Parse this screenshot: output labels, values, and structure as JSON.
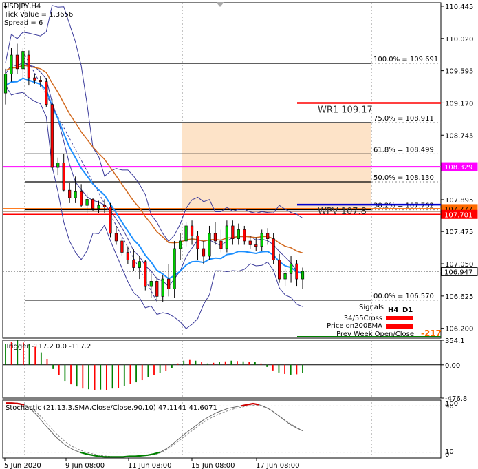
{
  "header": {
    "symbol": "USDJPY,H4",
    "tick_value": "Tick Value = 1.3656",
    "spread": "Spread = 6"
  },
  "chart_data": {
    "type": "candlestick",
    "price_axis": {
      "ticks": [
        "110.445",
        "110.020",
        "109.595",
        "109.170",
        "108.745",
        "108.320",
        "107.895",
        "107.475",
        "107.050",
        "106.625",
        "106.200"
      ],
      "ylim": [
        106.07,
        110.49
      ]
    },
    "price_tags": [
      {
        "value": 108.329,
        "label": "108.329",
        "bg": "#ff00ff",
        "fg": "#ffffff"
      },
      {
        "value": 107.777,
        "label": "107.777",
        "bg": "#ff6a00",
        "fg": "#000000"
      },
      {
        "value": 107.701,
        "label": "107.701",
        "bg": "#ff0000",
        "fg": "#ffffff"
      },
      {
        "value": 106.947,
        "label": "106.947",
        "bg": "#ffffff",
        "fg": "#000000"
      }
    ],
    "time_labels": [
      "5 Jun 2020",
      "9 Jun 08:00",
      "11 Jun 08:00",
      "15 Jun 08:00",
      "17 Jun 08:00"
    ],
    "fib_levels": [
      {
        "label": "100.0% = 109.691",
        "value": 109.691
      },
      {
        "label": "75.0% = 108.911",
        "value": 108.911
      },
      {
        "label": "61.8% = 108.499",
        "value": 108.499
      },
      {
        "label": "50.0% = 108.130",
        "value": 108.13
      },
      {
        "label": "38.2% = 107.762",
        "value": 107.762
      },
      {
        "label": "00.0% = 106.570",
        "value": 106.57
      }
    ],
    "levels": [
      {
        "name": "WR1",
        "value": 109.17,
        "label": "WR1   109.17",
        "color": "#ff0000"
      },
      {
        "name": "WPV",
        "value": 107.83,
        "label": "WPV   107.8",
        "color": "#0000cc"
      }
    ],
    "candles": [
      {
        "o": 109.3,
        "h": 109.62,
        "l": 109.15,
        "c": 109.55
      },
      {
        "o": 109.55,
        "h": 109.9,
        "l": 109.45,
        "c": 109.8
      },
      {
        "o": 109.8,
        "h": 109.95,
        "l": 109.55,
        "c": 109.62
      },
      {
        "o": 109.62,
        "h": 109.9,
        "l": 109.5,
        "c": 109.85
      },
      {
        "o": 109.8,
        "h": 109.86,
        "l": 109.4,
        "c": 109.5
      },
      {
        "o": 109.5,
        "h": 109.55,
        "l": 109.42,
        "c": 109.47
      },
      {
        "o": 109.47,
        "h": 109.52,
        "l": 109.38,
        "c": 109.45
      },
      {
        "o": 109.45,
        "h": 109.5,
        "l": 109.12,
        "c": 109.15
      },
      {
        "o": 109.15,
        "h": 109.22,
        "l": 108.28,
        "c": 108.32
      },
      {
        "o": 108.32,
        "h": 108.45,
        "l": 108.22,
        "c": 108.38
      },
      {
        "o": 108.38,
        "h": 108.5,
        "l": 108.0,
        "c": 108.02
      },
      {
        "o": 108.02,
        "h": 108.12,
        "l": 107.85,
        "c": 107.92
      },
      {
        "o": 107.92,
        "h": 108.2,
        "l": 107.85,
        "c": 108.0
      },
      {
        "o": 108.0,
        "h": 108.1,
        "l": 107.8,
        "c": 107.82
      },
      {
        "o": 107.82,
        "h": 107.98,
        "l": 107.72,
        "c": 107.9
      },
      {
        "o": 107.9,
        "h": 107.92,
        "l": 107.75,
        "c": 107.78
      },
      {
        "o": 107.78,
        "h": 107.88,
        "l": 107.72,
        "c": 107.82
      },
      {
        "o": 107.82,
        "h": 107.9,
        "l": 107.72,
        "c": 107.8
      },
      {
        "o": 107.8,
        "h": 107.85,
        "l": 107.4,
        "c": 107.45
      },
      {
        "o": 107.45,
        "h": 107.55,
        "l": 107.3,
        "c": 107.35
      },
      {
        "o": 107.35,
        "h": 107.4,
        "l": 107.15,
        "c": 107.2
      },
      {
        "o": 107.2,
        "h": 107.28,
        "l": 107.05,
        "c": 107.1
      },
      {
        "o": 107.1,
        "h": 107.25,
        "l": 106.95,
        "c": 107.0
      },
      {
        "o": 107.0,
        "h": 107.15,
        "l": 106.85,
        "c": 107.08
      },
      {
        "o": 107.08,
        "h": 107.1,
        "l": 106.7,
        "c": 106.75
      },
      {
        "o": 106.75,
        "h": 106.92,
        "l": 106.6,
        "c": 106.82
      },
      {
        "o": 106.82,
        "h": 106.88,
        "l": 106.55,
        "c": 106.62
      },
      {
        "o": 106.62,
        "h": 106.9,
        "l": 106.55,
        "c": 106.85
      },
      {
        "o": 106.85,
        "h": 107.05,
        "l": 106.62,
        "c": 106.72
      },
      {
        "o": 106.72,
        "h": 107.35,
        "l": 106.6,
        "c": 107.25
      },
      {
        "o": 107.25,
        "h": 107.45,
        "l": 107.1,
        "c": 107.35
      },
      {
        "o": 107.35,
        "h": 107.6,
        "l": 107.28,
        "c": 107.55
      },
      {
        "o": 107.55,
        "h": 107.62,
        "l": 107.3,
        "c": 107.42
      },
      {
        "o": 107.42,
        "h": 107.48,
        "l": 107.1,
        "c": 107.25
      },
      {
        "o": 107.25,
        "h": 107.35,
        "l": 107.05,
        "c": 107.15
      },
      {
        "o": 107.15,
        "h": 107.55,
        "l": 107.1,
        "c": 107.45
      },
      {
        "o": 107.45,
        "h": 107.6,
        "l": 107.3,
        "c": 107.35
      },
      {
        "o": 107.35,
        "h": 107.5,
        "l": 107.2,
        "c": 107.25
      },
      {
        "o": 107.25,
        "h": 107.62,
        "l": 107.2,
        "c": 107.55
      },
      {
        "o": 107.55,
        "h": 107.62,
        "l": 107.3,
        "c": 107.38
      },
      {
        "o": 107.38,
        "h": 107.58,
        "l": 107.3,
        "c": 107.5
      },
      {
        "o": 107.5,
        "h": 107.55,
        "l": 107.3,
        "c": 107.35
      },
      {
        "o": 107.35,
        "h": 107.42,
        "l": 107.25,
        "c": 107.3
      },
      {
        "o": 107.3,
        "h": 107.4,
        "l": 107.22,
        "c": 107.28
      },
      {
        "o": 107.28,
        "h": 107.5,
        "l": 107.22,
        "c": 107.45
      },
      {
        "o": 107.45,
        "h": 107.52,
        "l": 107.3,
        "c": 107.38
      },
      {
        "o": 107.38,
        "h": 107.45,
        "l": 107.05,
        "c": 107.1
      },
      {
        "o": 107.1,
        "h": 107.18,
        "l": 106.8,
        "c": 106.85
      },
      {
        "o": 106.85,
        "h": 106.98,
        "l": 106.75,
        "c": 106.92
      },
      {
        "o": 106.92,
        "h": 107.15,
        "l": 106.8,
        "c": 107.05
      },
      {
        "o": 107.05,
        "h": 107.1,
        "l": 106.75,
        "c": 106.85
      },
      {
        "o": 106.85,
        "h": 107.0,
        "l": 106.72,
        "c": 106.95
      }
    ],
    "signals": {
      "title": "Signals",
      "h4": "H4",
      "d1": "D1",
      "rows": [
        "34/55Cross",
        "Price on200EMA",
        "Prev Week Open/Close"
      ],
      "row_value": "-217"
    },
    "trigger": {
      "label": "Trigger -117.2 0.0 -117.2",
      "ticks": [
        "354.1",
        "0.00",
        "-476.8"
      ],
      "ylim": [
        -476.8,
        354.1
      ],
      "values": [
        300,
        330,
        350,
        320,
        300,
        260,
        180,
        80,
        -60,
        -150,
        -230,
        -280,
        -310,
        -340,
        -350,
        -360,
        -355,
        -360,
        -340,
        -330,
        -300,
        -270,
        -250,
        -220,
        -180,
        -150,
        -120,
        -90,
        -50,
        20,
        60,
        70,
        60,
        40,
        20,
        30,
        40,
        50,
        60,
        55,
        50,
        45,
        40,
        20,
        -30,
        -80,
        -110,
        -130,
        -140,
        -135,
        -117
      ]
    },
    "stochastic": {
      "label": "Stochastic (21,13,3,SMA,Close/Close,90,10) 47.1141 41.6071",
      "ticks": [
        "100",
        "90",
        "10",
        "0"
      ],
      "ylim": [
        0,
        100
      ],
      "main": [
        95,
        95,
        94,
        92,
        85,
        75,
        62,
        50,
        38,
        28,
        20,
        14,
        10,
        7,
        5,
        3,
        2,
        2,
        2,
        2,
        3,
        3,
        4,
        5,
        7,
        10,
        16,
        24,
        33,
        42,
        50,
        58,
        66,
        72,
        78,
        82,
        86,
        88,
        90,
        92,
        94,
        92,
        88,
        82,
        74,
        66,
        58,
        52,
        47
      ],
      "signal": [
        94,
        95,
        95,
        93,
        88,
        80,
        70,
        58,
        46,
        36,
        27,
        20,
        15,
        11,
        8,
        6,
        4,
        3,
        2,
        2,
        2,
        3,
        3,
        4,
        5,
        7,
        11,
        17,
        25,
        33,
        41,
        49,
        57,
        64,
        70,
        75,
        79,
        83,
        86,
        88,
        90,
        91,
        90,
        87,
        81,
        74,
        66,
        59,
        53,
        47
      ]
    }
  }
}
